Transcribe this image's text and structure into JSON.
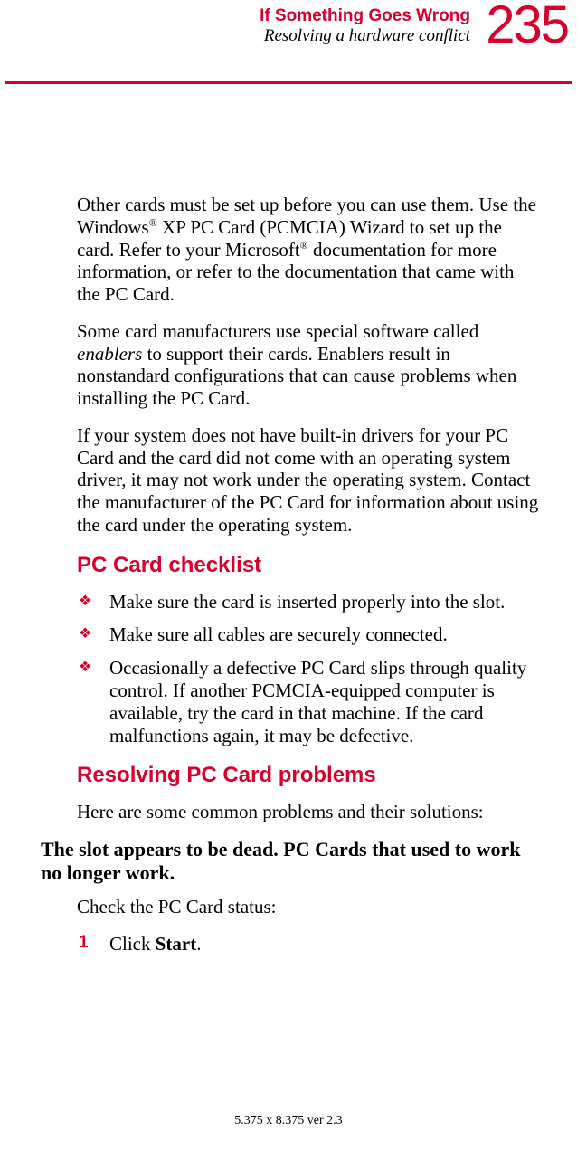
{
  "header": {
    "page_number": "235",
    "chapter": "If Something Goes Wrong",
    "section": "Resolving a hardware conflict"
  },
  "body": {
    "p1_a": "Other cards must be set up before you can use them. Use the Windows",
    "p1_b": " XP PC Card (PCMCIA) Wizard to set up the card. Refer to your Microsoft",
    "p1_c": " documentation for more information, or refer to the documentation that came with the PC Card.",
    "p2_a": "Some card manufacturers use special software called ",
    "p2_em": "enablers",
    "p2_b": " to support their cards. Enablers result in nonstandard configurations that can cause problems when installing the PC Card.",
    "p3": "If your system does not have built-in drivers for your PC Card and the card did not come with an operating system driver, it may not work under the operating system. Contact the manufacturer of the PC Card for information about using the card under the operating system.",
    "h_checklist": "PC Card checklist",
    "bullets": [
      "Make sure the card is inserted properly into the slot.",
      "Make sure all cables are securely connected.",
      "Occasionally a defective PC Card slips through quality control. If another PCMCIA-equipped computer is available, try the card in that machine. If the card malfunctions again, it may be defective."
    ],
    "h_resolving": "Resolving PC Card problems",
    "p4": "Here are some common problems and their solutions:",
    "problem1": "The slot appears to be dead. PC Cards that used to work no longer work.",
    "p5": "Check the PC Card status:",
    "steps": [
      {
        "num": "1",
        "pre": "Click ",
        "bold": "Start",
        "post": "."
      }
    ]
  },
  "footer": "5.375 x 8.375 ver 2.3",
  "glyphs": {
    "reg": "®",
    "diamond": "❖"
  }
}
